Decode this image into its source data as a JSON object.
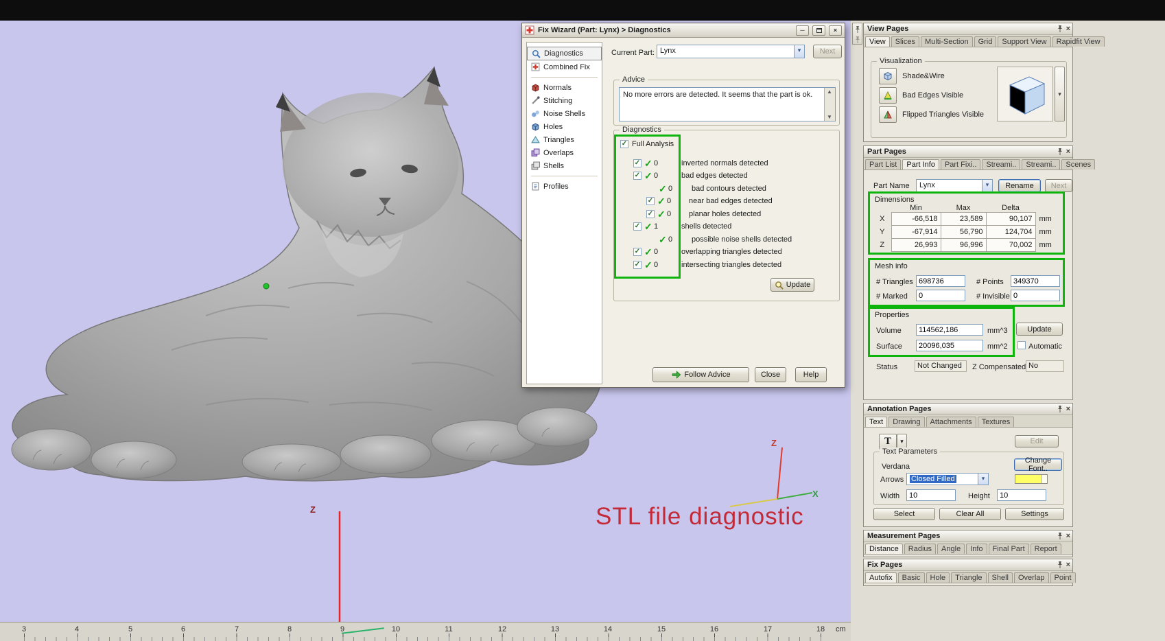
{
  "icons": {
    "dropdown": "▾",
    "close": "×",
    "minimize": "─",
    "scroll_up": "▲",
    "scroll_down": "▼",
    "check": "✓"
  },
  "viewport": {
    "caption": "STL file diagnostic",
    "origin_axis": "Z",
    "triad": {
      "z": "Z",
      "x": "X"
    },
    "ruler_ticks": [
      "3",
      "4",
      "5",
      "6",
      "7",
      "8",
      "9",
      "10",
      "11",
      "12",
      "13",
      "14",
      "15",
      "16",
      "17",
      "18"
    ],
    "ruler_unit": "cm"
  },
  "fix_wizard": {
    "title": "Fix Wizard (Part: Lynx) > Diagnostics",
    "nav": [
      "Diagnostics",
      "Combined Fix",
      "Normals",
      "Stitching",
      "Noise Shells",
      "Holes",
      "Triangles",
      "Overlaps",
      "Shells",
      "Profiles"
    ],
    "current_part_label": "Current Part:",
    "current_part_value": "Lynx",
    "next_button": "Next",
    "advice_title": "Advice",
    "advice_text": "No more errors are detected. It seems that the part is ok.",
    "diag_title": "Diagnostics",
    "full_analysis": "Full Analysis",
    "rows": [
      {
        "count": "0",
        "label": "inverted normals detected"
      },
      {
        "count": "0",
        "label": "bad edges detected"
      },
      {
        "count": "0",
        "label": "bad contours detected"
      },
      {
        "count": "0",
        "label": "near bad edges detected"
      },
      {
        "count": "0",
        "label": "planar holes detected"
      },
      {
        "count": "1",
        "label": "shells detected"
      },
      {
        "count": "0",
        "label": "possible noise shells detected"
      },
      {
        "count": "0",
        "label": "overlapping triangles detected"
      },
      {
        "count": "0",
        "label": "intersecting triangles detected"
      }
    ],
    "update_button": "Update",
    "follow_advice_button": "Follow Advice",
    "close_button": "Close",
    "help_button": "Help"
  },
  "view_pages": {
    "title": "View Pages",
    "tabs": [
      "View",
      "Slices",
      "Multi-Section",
      "Grid",
      "Support View",
      "Rapidfit View"
    ],
    "group_title": "Visualization",
    "options": [
      "Shade&Wire",
      "Bad Edges Visible",
      "Flipped Triangles Visible"
    ]
  },
  "part_pages": {
    "title": "Part Pages",
    "tabs": [
      "Part List",
      "Part Info",
      "Part Fixi..",
      "Streami..",
      "Streami..",
      "Scenes"
    ],
    "part_name_label": "Part Name",
    "part_name_value": "Lynx",
    "rename_button": "Rename",
    "next_button": "Next",
    "dim_title": "Dimensions",
    "dim_headers": [
      "Min",
      "Max",
      "Delta"
    ],
    "dim_rows": [
      {
        "axis": "X",
        "min": "-66,518",
        "max": "23,589",
        "delta": "90,107",
        "unit": "mm"
      },
      {
        "axis": "Y",
        "min": "-67,914",
        "max": "56,790",
        "delta": "124,704",
        "unit": "mm"
      },
      {
        "axis": "Z",
        "min": "26,993",
        "max": "96,996",
        "delta": "70,002",
        "unit": "mm"
      }
    ],
    "mesh_title": "Mesh info",
    "mesh": {
      "triangles_label": "# Triangles",
      "triangles": "698736",
      "points_label": "# Points",
      "points": "349370",
      "marked_label": "# Marked",
      "marked": "0",
      "invisible_label": "# Invisible",
      "invisible": "0"
    },
    "prop_title": "Properties",
    "props": {
      "volume_label": "Volume",
      "volume": "114562,186",
      "volume_unit": "mm^3",
      "surface_label": "Surface",
      "surface": "20096,035",
      "surface_unit": "mm^2",
      "update_button": "Update",
      "automatic_label": "Automatic"
    },
    "status_label": "Status",
    "status_value": "Not Changed",
    "zcomp_label": "Z Compensated",
    "zcomp_value": "No"
  },
  "annotation_pages": {
    "title": "Annotation Pages",
    "tabs": [
      "Text",
      "Drawing",
      "Attachments",
      "Textures"
    ],
    "text_tool": "T",
    "edit_button": "Edit",
    "group_title": "Text Parameters",
    "font_name": "Verdana",
    "change_font_button": "Change Font..",
    "arrows_label": "Arrows",
    "arrows_value": "Closed Filled",
    "width_label": "Width",
    "width_value": "10",
    "height_label": "Height",
    "height_value": "10",
    "select_button": "Select",
    "clear_all_button": "Clear All",
    "settings_button": "Settings"
  },
  "measurement_pages": {
    "title": "Measurement Pages",
    "tabs": [
      "Distance",
      "Radius",
      "Angle",
      "Info",
      "Final Part",
      "Report"
    ]
  },
  "fix_pages": {
    "title": "Fix Pages",
    "tabs": [
      "Autofix",
      "Basic",
      "Hole",
      "Triangle",
      "Shell",
      "Overlap",
      "Point"
    ]
  }
}
